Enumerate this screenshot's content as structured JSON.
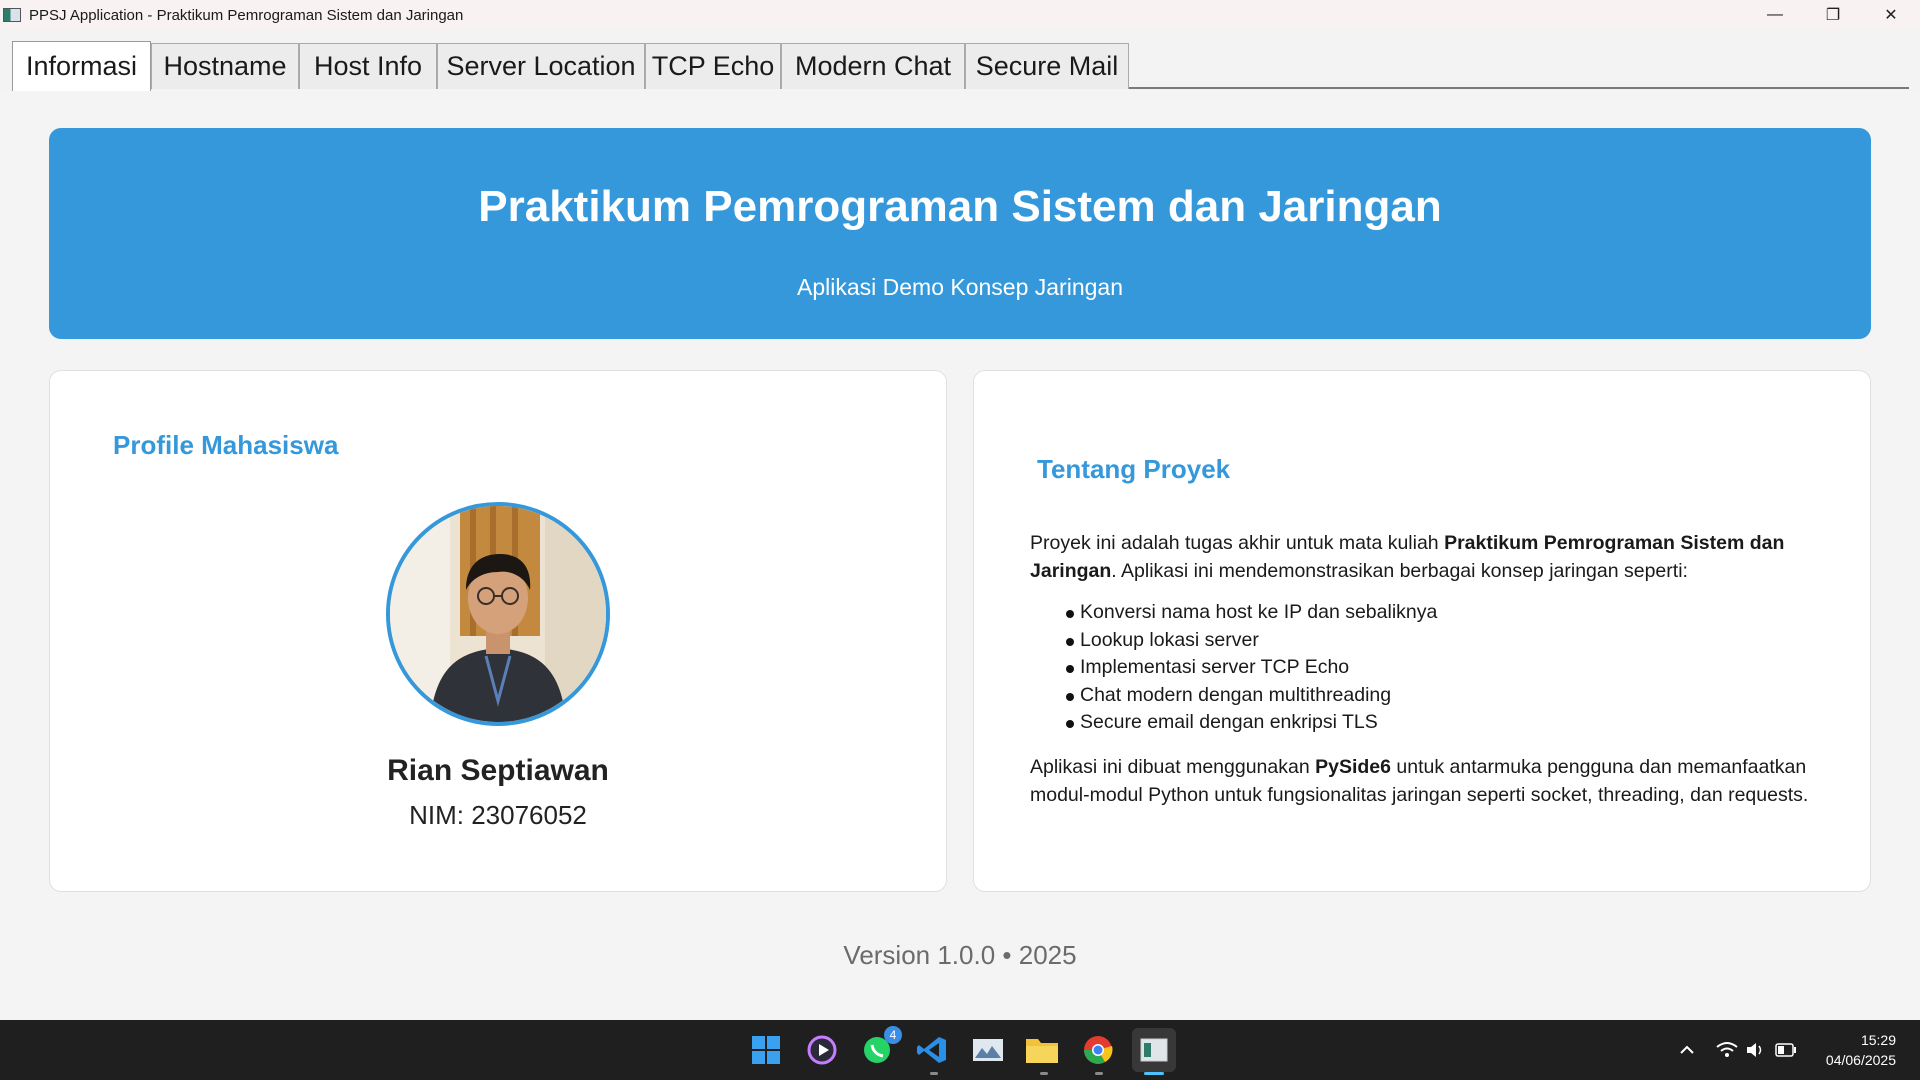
{
  "window": {
    "title": "PPSJ Application - Praktikum Pemrograman Sistem dan Jaringan",
    "minimize_glyph": "—",
    "restore_glyph": "❐",
    "close_glyph": "✕"
  },
  "tabs": [
    {
      "label": "Informasi",
      "active": true
    },
    {
      "label": "Hostname",
      "active": false
    },
    {
      "label": "Host Info",
      "active": false
    },
    {
      "label": "Server Location",
      "active": false
    },
    {
      "label": "TCP Echo",
      "active": false
    },
    {
      "label": "Modern Chat",
      "active": false
    },
    {
      "label": "Secure Mail",
      "active": false
    }
  ],
  "banner": {
    "title": "Praktikum Pemrograman Sistem dan Jaringan",
    "subtitle": "Aplikasi Demo Konsep Jaringan"
  },
  "profile": {
    "heading": "Profile Mahasiswa",
    "name": "Rian Septiawan",
    "nim": "NIM: 23076052"
  },
  "about": {
    "heading": "Tentang Proyek",
    "intro_1": "Proyek ini adalah tugas akhir untuk mata kuliah ",
    "intro_bold": "Praktikum Pemrograman Sistem dan Jaringan",
    "intro_2": ". Aplikasi ini mendemonstrasikan berbagai konsep jaringan seperti:",
    "items": [
      "Konversi nama host ke IP dan sebaliknya",
      "Lookup lokasi server",
      "Implementasi server TCP Echo",
      "Chat modern dengan multithreading",
      "Secure email dengan enkripsi TLS"
    ],
    "outro_1": "Aplikasi ini dibuat menggunakan ",
    "outro_bold": "PySide6",
    "outro_2": " untuk antarmuka pengguna dan memanfaatkan modul-modul Python untuk fungsionalitas jaringan seperti socket, threading, dan requests."
  },
  "footer": {
    "version": "Version 1.0.0 • 2025"
  },
  "taskbar": {
    "whatsapp_badge": "4",
    "time": "15:29",
    "date": "04/06/2025"
  },
  "colors": {
    "accent": "#3498db",
    "taskbar": "#1f1f1f"
  }
}
